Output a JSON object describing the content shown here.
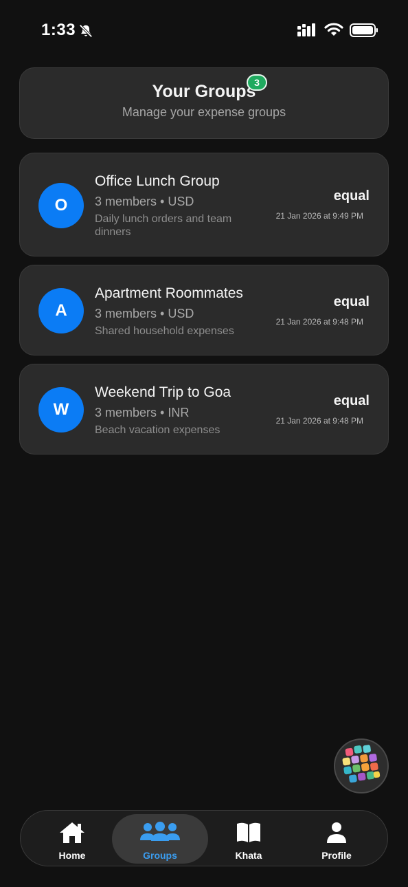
{
  "status_bar": {
    "time": "1:33",
    "icons": [
      "bell-slash-icon",
      "signal-icon",
      "wifi-icon",
      "battery-icon"
    ]
  },
  "header": {
    "title": "Your Groups",
    "badge_count": "3",
    "subtitle": "Manage your expense groups"
  },
  "groups": [
    {
      "initial": "O",
      "name": "Office Lunch Group",
      "meta": "3 members • USD",
      "description": "Daily lunch orders and team dinners",
      "split": "equal",
      "date": "21 Jan 2026 at 9:49 PM"
    },
    {
      "initial": "A",
      "name": "Apartment Roommates",
      "meta": "3 members • USD",
      "description": "Shared household expenses",
      "split": "equal",
      "date": "21 Jan 2026 at 9:48 PM"
    },
    {
      "initial": "W",
      "name": "Weekend Trip to Goa",
      "meta": "3 members • INR",
      "description": "Beach vacation expenses",
      "split": "equal",
      "date": "21 Jan 2026 at 9:48 PM"
    }
  ],
  "fab": {
    "icon": "app-grid-icon"
  },
  "nav": {
    "active": "Groups",
    "items": [
      {
        "label": "Home",
        "icon": "home-icon"
      },
      {
        "label": "Groups",
        "icon": "groups-icon"
      },
      {
        "label": "Khata",
        "icon": "book-icon"
      },
      {
        "label": "Profile",
        "icon": "profile-icon"
      }
    ]
  },
  "colors": {
    "background": "#111111",
    "card": "#2b2b2b",
    "avatar": "#0b7cf5",
    "badge": "#1faa5f",
    "nav_active": "#3a9df0"
  }
}
